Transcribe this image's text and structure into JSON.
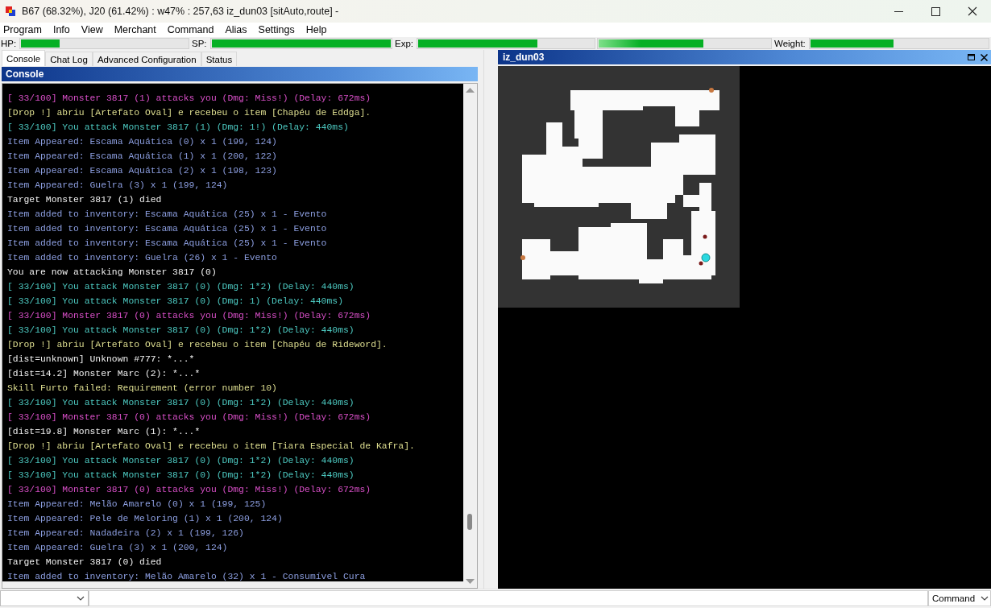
{
  "window": {
    "title": "B67 (68.32%), J20 (61.42%) : w47% : 257,63 iz_dun03 [sitAuto,route] -"
  },
  "menu": [
    "Program",
    "Info",
    "View",
    "Merchant",
    "Command",
    "Alias",
    "Settings",
    "Help"
  ],
  "stats": [
    {
      "label": "HP:",
      "level": 0.23
    },
    {
      "label": "SP:",
      "level": 1.0
    },
    {
      "label": "Exp:",
      "level": 0.68,
      "kind": "base"
    },
    {
      "level": 0.61,
      "kind": "job"
    },
    {
      "label": "Weight:",
      "level": 0.47
    }
  ],
  "tabs": [
    {
      "label": "Console",
      "selected": true
    },
    {
      "label": "Chat Log",
      "selected": false
    },
    {
      "label": "Advanced Configuration",
      "selected": false
    },
    {
      "label": "Status",
      "selected": false
    }
  ],
  "console": {
    "title": "Console",
    "lines": [
      {
        "kind": "hit",
        "text": "[ 33/100] Monster 3817 (1) attacks you (Dmg: Miss!) (Delay: 672ms)"
      },
      {
        "kind": "drop",
        "text": "[Drop !] abriu [Artefato Oval] e recebeu o item [Chapéu de Eddga]."
      },
      {
        "kind": "attack",
        "text": "[ 33/100] You attack Monster 3817 (1) (Dmg: 1!) (Delay: 440ms)"
      },
      {
        "kind": "item",
        "text": "Item Appeared: Escama Aquática (0) x 1 (199, 124)"
      },
      {
        "kind": "item",
        "text": "Item Appeared: Escama Aquática (1) x 1 (200, 122)"
      },
      {
        "kind": "item",
        "text": "Item Appeared: Escama Aquática (2) x 1 (198, 123)"
      },
      {
        "kind": "item",
        "text": "Item Appeared: Guelra (3) x 1 (199, 124)"
      },
      {
        "kind": "plain",
        "text": "Target Monster 3817 (1) died"
      },
      {
        "kind": "item",
        "text": "Item added to inventory: Escama Aquática (25) x 1 - Evento"
      },
      {
        "kind": "item",
        "text": "Item added to inventory: Escama Aquática (25) x 1 - Evento"
      },
      {
        "kind": "item",
        "text": "Item added to inventory: Escama Aquática (25) x 1 - Evento"
      },
      {
        "kind": "item",
        "text": "Item added to inventory: Guelra (26) x 1 - Evento"
      },
      {
        "kind": "plain",
        "text": "You are now attacking Monster 3817 (0)"
      },
      {
        "kind": "attack",
        "text": "[ 33/100] You attack Monster 3817 (0) (Dmg: 1*2) (Delay: 440ms)"
      },
      {
        "kind": "attack",
        "text": "[ 33/100] You attack Monster 3817 (0) (Dmg: 1) (Delay: 440ms)"
      },
      {
        "kind": "hit",
        "text": "[ 33/100] Monster 3817 (0) attacks you (Dmg: Miss!) (Delay: 672ms)"
      },
      {
        "kind": "attack",
        "text": "[ 33/100] You attack Monster 3817 (0) (Dmg: 1*2) (Delay: 440ms)"
      },
      {
        "kind": "drop",
        "text": "[Drop !] abriu [Artefato Oval] e recebeu o item [Chapéu de Rideword]."
      },
      {
        "kind": "plain",
        "text": "[dist=unknown] Unknown #777: *...*"
      },
      {
        "kind": "plain",
        "text": "[dist=14.2] Monster Marc (2): *...*"
      },
      {
        "kind": "drop",
        "text": "Skill Furto failed: Requirement (error number 10)"
      },
      {
        "kind": "attack",
        "text": "[ 33/100] You attack Monster 3817 (0) (Dmg: 1*2) (Delay: 440ms)"
      },
      {
        "kind": "hit",
        "text": "[ 33/100] Monster 3817 (0) attacks you (Dmg: Miss!) (Delay: 672ms)"
      },
      {
        "kind": "plain",
        "text": "[dist=19.8] Monster Marc (1): *...*"
      },
      {
        "kind": "drop",
        "text": "[Drop !] abriu [Artefato Oval] e recebeu o item [Tiara Especial de Kafra]."
      },
      {
        "kind": "attack",
        "text": "[ 33/100] You attack Monster 3817 (0) (Dmg: 1*2) (Delay: 440ms)"
      },
      {
        "kind": "attack",
        "text": "[ 33/100] You attack Monster 3817 (0) (Dmg: 1*2) (Delay: 440ms)"
      },
      {
        "kind": "hit",
        "text": "[ 33/100] Monster 3817 (0) attacks you (Dmg: Miss!) (Delay: 672ms)"
      },
      {
        "kind": "item",
        "text": "Item Appeared: Melão Amarelo (0) x 1 (199, 125)"
      },
      {
        "kind": "item",
        "text": "Item Appeared: Pele de Meloring (1) x 1 (200, 124)"
      },
      {
        "kind": "item",
        "text": "Item Appeared: Nadadeira (2) x 1 (199, 126)"
      },
      {
        "kind": "item",
        "text": "Item Appeared: Guelra (3) x 1 (200, 124)"
      },
      {
        "kind": "plain",
        "text": "Target Monster 3817 (0) died"
      },
      {
        "kind": "item",
        "text": "Item added to inventory: Melão Amarelo (32) x 1 - Consumível Cura"
      }
    ]
  },
  "map_window": {
    "title": "iz_dun03"
  },
  "command_bar": {
    "mode": "Command"
  }
}
